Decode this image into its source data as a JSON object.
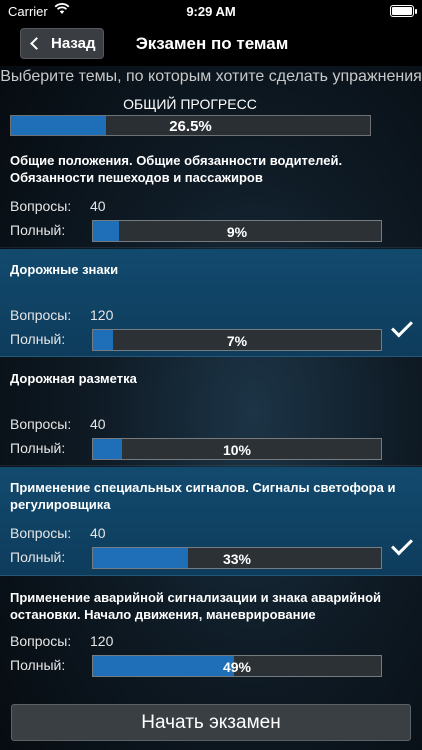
{
  "status": {
    "carrier": "Carrier",
    "time": "9:29 AM"
  },
  "nav": {
    "back_label": "Назад",
    "title": "Экзамен по темам"
  },
  "subtitle": "Выберите темы, по которым хотите сделать упражнения",
  "overall": {
    "label": "ОБЩИЙ ПРОГРЕСС",
    "percent_text": "26.5%",
    "percent": 26.5
  },
  "labels": {
    "questions": "Вопросы:",
    "complete": "Полный:"
  },
  "topics": [
    {
      "title": "Общие положения. Общие обязанности водителей. Обязанности пешеходов и пассажиров",
      "questions": "40",
      "percent_text": "9%",
      "percent": 9,
      "selected": false
    },
    {
      "title": "Дорожные знаки",
      "questions": "120",
      "percent_text": "7%",
      "percent": 7,
      "selected": true
    },
    {
      "title": "Дорожная разметка",
      "questions": "40",
      "percent_text": "10%",
      "percent": 10,
      "selected": false
    },
    {
      "title": "Применение специальных сигналов. Сигналы светофора и регулировщика",
      "questions": "40",
      "percent_text": "33%",
      "percent": 33,
      "selected": true
    },
    {
      "title": "Применение аварийной сигнализации и знака аварийной остановки. Начало движения, маневрирование",
      "questions": "120",
      "percent_text": "49%",
      "percent": 49,
      "selected": false
    }
  ],
  "start_button": "Начать экзамен",
  "colors": {
    "accent": "#1f6fb8",
    "selected_bg": "#124a6e"
  }
}
